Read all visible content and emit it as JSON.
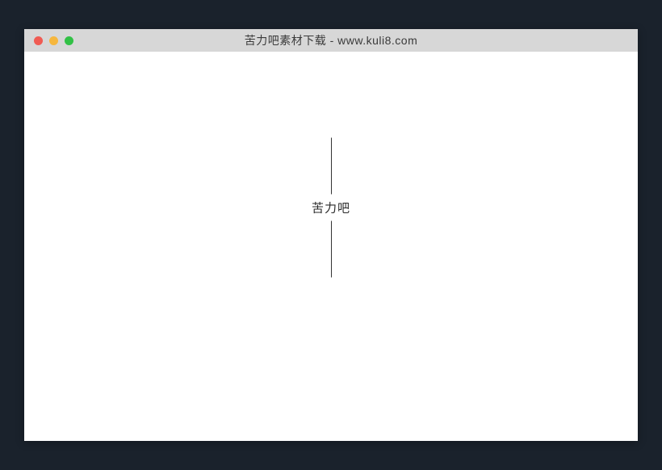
{
  "window": {
    "title": "苦力吧素材下载 - www.kuli8.com"
  },
  "content": {
    "center_text": "苦力吧"
  }
}
